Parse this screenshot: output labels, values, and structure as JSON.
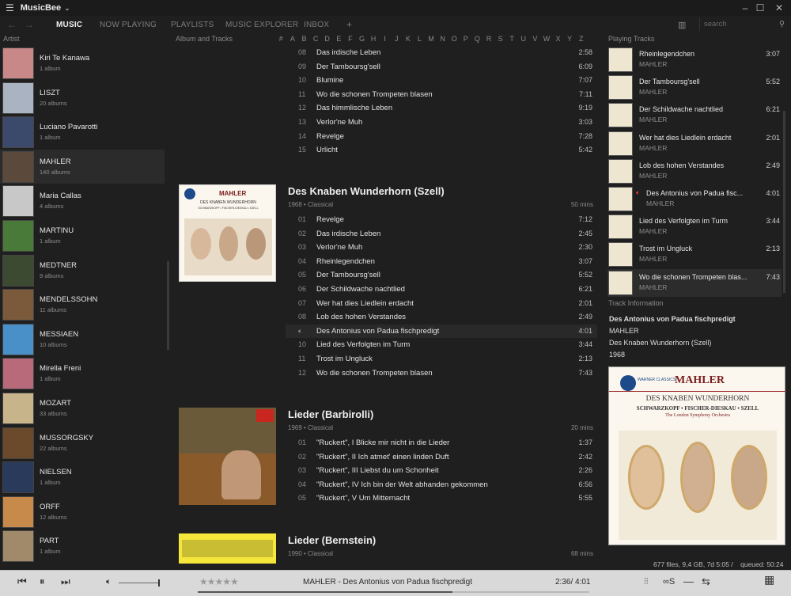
{
  "app": {
    "title": "MusicBee"
  },
  "tabs": [
    "MUSIC",
    "NOW PLAYING",
    "PLAYLISTS",
    "MUSIC EXPLORER",
    "INBOX",
    "+"
  ],
  "search": {
    "placeholder": "search"
  },
  "columns": {
    "artist": "Artist",
    "album_tracks": "Album and Tracks",
    "playing": "Playing Tracks",
    "info": "Track Information"
  },
  "az": [
    "#",
    "A",
    "B",
    "C",
    "D",
    "E",
    "F",
    "G",
    "H",
    "I",
    "J",
    "K",
    "L",
    "M",
    "N",
    "O",
    "P",
    "Q",
    "R",
    "S",
    "T",
    "U",
    "V",
    "W",
    "X",
    "Y",
    "Z"
  ],
  "artists": [
    {
      "name": "Kiri Te Kanawa",
      "count": "1 album",
      "color": "#c98888"
    },
    {
      "name": "LISZT",
      "count": "20 albums",
      "color": "#a9b3c2"
    },
    {
      "name": "Luciano Pavarotti",
      "count": "1 album",
      "color": "#3b4a6a"
    },
    {
      "name": "MAHLER",
      "count": "140 albums",
      "color": "#5b4a3b"
    },
    {
      "name": "Maria Callas",
      "count": "4 albums",
      "color": "#c8c8c8"
    },
    {
      "name": "MARTINU",
      "count": "1 album",
      "color": "#4a7a3a"
    },
    {
      "name": "MEDTNER",
      "count": "9 albums",
      "color": "#3c4a32"
    },
    {
      "name": "MENDELSSOHN",
      "count": "11 albums",
      "color": "#7a5a3a"
    },
    {
      "name": "MESSIAEN",
      "count": "10 albums",
      "color": "#4a90c8"
    },
    {
      "name": "Mirella Freni",
      "count": "1 album",
      "color": "#b86a7a"
    },
    {
      "name": "MOZART",
      "count": "33 albums",
      "color": "#c8b48a"
    },
    {
      "name": "MUSSORGSKY",
      "count": "22 albums",
      "color": "#6a4a2a"
    },
    {
      "name": "NIELSEN",
      "count": "1 album",
      "color": "#2a3a5a"
    },
    {
      "name": "ORFF",
      "count": "12 albums",
      "color": "#c88a4a"
    },
    {
      "name": "PART",
      "count": "1 album",
      "color": "#a08a6a"
    }
  ],
  "prev_tracks": [
    {
      "no": "08",
      "title": "Das irdische Leben",
      "dur": "2:58"
    },
    {
      "no": "09",
      "title": "Der Tamboursg'sell",
      "dur": "6:09"
    },
    {
      "no": "10",
      "title": "Blumine",
      "dur": "7:07"
    },
    {
      "no": "11",
      "title": "Wo die schonen Trompeten blasen",
      "dur": "7:11"
    },
    {
      "no": "12",
      "title": "Das himmlische Leben",
      "dur": "9:19"
    },
    {
      "no": "13",
      "title": "Verlor'ne Muh",
      "dur": "3:03"
    },
    {
      "no": "14",
      "title": "Revelge",
      "dur": "7:28"
    },
    {
      "no": "15",
      "title": "Urlicht",
      "dur": "5:42"
    }
  ],
  "albums": [
    {
      "title": "Des Knaben Wunderhorn (Szell)",
      "meta": "1968 • Classical",
      "mins": "50 mins",
      "cover": {
        "label": "MAHLER",
        "sub": "DES KNABEN WUNDERHORN",
        "names": "SCHWARZKOPF • FISCHER-DIESKAU • SZELL",
        "orch": "The London Symphony Orchestra",
        "brand": "WARNER CLASSICS"
      },
      "tracks": [
        {
          "no": "01",
          "title": "Revelge",
          "dur": "7:12"
        },
        {
          "no": "02",
          "title": "Das irdische Leben",
          "dur": "2:45"
        },
        {
          "no": "03",
          "title": "Verlor'ne Muh",
          "dur": "2:30"
        },
        {
          "no": "04",
          "title": "Rheinlegendchen",
          "dur": "3:07"
        },
        {
          "no": "05",
          "title": "Der Tamboursg'sell",
          "dur": "5:52"
        },
        {
          "no": "06",
          "title": "Der Schildwache nachtlied",
          "dur": "6:21"
        },
        {
          "no": "07",
          "title": "Wer hat dies Liedlein erdacht",
          "dur": "2:01"
        },
        {
          "no": "08",
          "title": "Lob des hohen Verstandes",
          "dur": "2:49"
        },
        {
          "no": "",
          "title": "Des Antonius von Padua fischpredigt",
          "dur": "4:01",
          "playing": true
        },
        {
          "no": "10",
          "title": "Lied des Verfolgten im Turm",
          "dur": "3:44"
        },
        {
          "no": "11",
          "title": "Trost im Ungluck",
          "dur": "2:13"
        },
        {
          "no": "12",
          "title": "Wo die schonen Trompeten blasen",
          "dur": "7:43"
        }
      ]
    },
    {
      "title": "Lieder (Barbirolli)",
      "meta": "1969 • Classical",
      "mins": "20 mins",
      "tracks": [
        {
          "no": "01",
          "title": "\"Ruckert\", I  Blicke mir nicht in die Lieder",
          "dur": "1:37"
        },
        {
          "no": "02",
          "title": "\"Ruckert\", II  Ich atmet' einen linden Duft",
          "dur": "2:42"
        },
        {
          "no": "03",
          "title": "\"Ruckert\", III  Liebst du um Schonheit",
          "dur": "2:26"
        },
        {
          "no": "04",
          "title": "\"Ruckert\", IV  Ich bin der Welt abhanden gekommen",
          "dur": "6:56"
        },
        {
          "no": "05",
          "title": "\"Ruckert\", V  Um Mitternacht",
          "dur": "5:55"
        }
      ]
    },
    {
      "title": "Lieder (Bernstein)",
      "meta": "1990 • Classical",
      "mins": "68 mins",
      "tracks": []
    }
  ],
  "playing": [
    {
      "title": "Rheinlegendchen",
      "artist": "MAHLER",
      "dur": "3:07"
    },
    {
      "title": "Der Tamboursg'sell",
      "artist": "MAHLER",
      "dur": "5:52"
    },
    {
      "title": "Der Schildwache nachtlied",
      "artist": "MAHLER",
      "dur": "6:21"
    },
    {
      "title": "Wer hat dies Liedlein erdacht",
      "artist": "MAHLER",
      "dur": "2:01"
    },
    {
      "title": "Lob des hohen Verstandes",
      "artist": "MAHLER",
      "dur": "2:49"
    },
    {
      "title": "Des Antonius von Padua fisc...",
      "artist": "MAHLER",
      "dur": "4:01",
      "current": true
    },
    {
      "title": "Lied des Verfolgten im Turm",
      "artist": "MAHLER",
      "dur": "3:44"
    },
    {
      "title": "Trost im Ungluck",
      "artist": "MAHLER",
      "dur": "2:13"
    },
    {
      "title": "Wo die schonen Trompeten blas...",
      "artist": "MAHLER",
      "dur": "7:43",
      "sel": true
    }
  ],
  "track_info": {
    "title": "Des Antonius von Padua fischpredigt",
    "artist": "MAHLER",
    "album": "Des Knaben Wunderhorn (Szell)",
    "year": "1968"
  },
  "status": {
    "files": "677 files, 9,4 GB, 7d 5:05 /",
    "queued": "queued: 50:24"
  },
  "player": {
    "now_playing": "MAHLER - Des Antonius von Padua fischpredigt",
    "time": "2:36/ 4:01",
    "progress": 0.65,
    "stars": "★★★★★",
    "volume": 1.0
  }
}
